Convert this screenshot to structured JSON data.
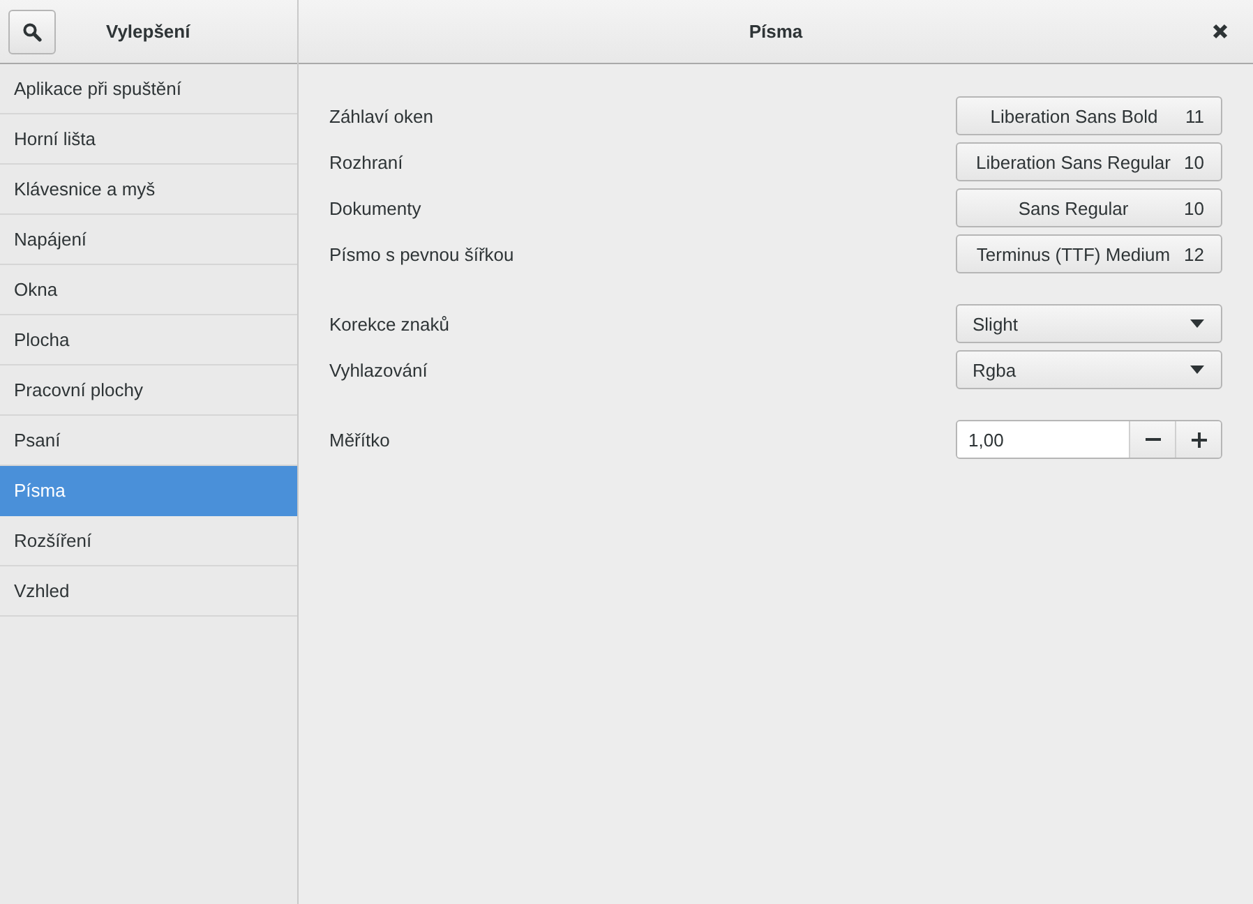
{
  "sidebar": {
    "title": "Vylepšení",
    "items": [
      {
        "label": "Aplikace při spuštění",
        "selected": false
      },
      {
        "label": "Horní lišta",
        "selected": false
      },
      {
        "label": "Klávesnice a myš",
        "selected": false
      },
      {
        "label": "Napájení",
        "selected": false
      },
      {
        "label": "Okna",
        "selected": false
      },
      {
        "label": "Plocha",
        "selected": false
      },
      {
        "label": "Pracovní plochy",
        "selected": false
      },
      {
        "label": "Psaní",
        "selected": false
      },
      {
        "label": "Písma",
        "selected": true
      },
      {
        "label": "Rozšíření",
        "selected": false
      },
      {
        "label": "Vzhled",
        "selected": false
      }
    ]
  },
  "page": {
    "title": "Písma",
    "groups": [
      [
        {
          "kind": "font",
          "label": "Záhlaví oken",
          "font": "Liberation Sans Bold",
          "size": "11"
        },
        {
          "kind": "font",
          "label": "Rozhraní",
          "font": "Liberation Sans Regular",
          "size": "10"
        },
        {
          "kind": "font",
          "label": "Dokumenty",
          "font": "Sans Regular",
          "size": "10"
        },
        {
          "kind": "font",
          "label": "Písmo s pevnou šířkou",
          "font": "Terminus (TTF) Medium",
          "size": "12"
        }
      ],
      [
        {
          "kind": "dropdown",
          "label": "Korekce znaků",
          "value": "Slight"
        },
        {
          "kind": "dropdown",
          "label": "Vyhlazování",
          "value": "Rgba"
        }
      ],
      [
        {
          "kind": "spin",
          "label": "Měřítko",
          "value": "1,00"
        }
      ]
    ]
  }
}
